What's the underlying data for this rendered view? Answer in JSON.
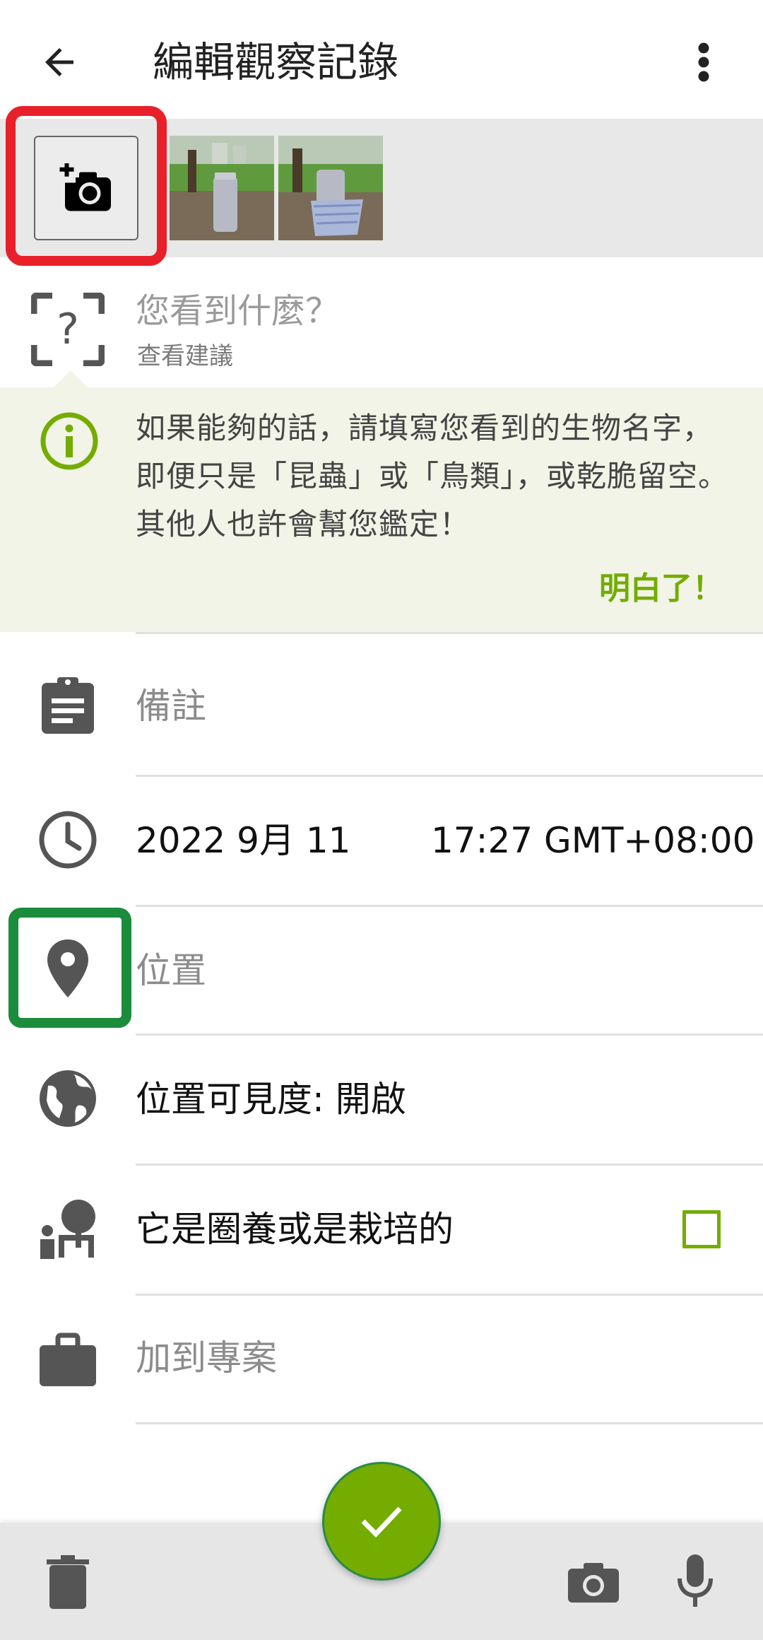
{
  "header": {
    "title": "編輯觀察記錄"
  },
  "species": {
    "question": "您看到什麼？",
    "suggestions": "查看建議"
  },
  "tip": {
    "text": "如果能夠的話，請填寫您看到的生物名字，即便只是「昆蟲」或「鳥類」，或乾脆留空。其他人也許會幫您鑑定！",
    "ok_label": "明白了！"
  },
  "notes": {
    "placeholder": "備註"
  },
  "datetime": {
    "date": "2022 9月 11",
    "time": "17:27 GMT+08:00"
  },
  "location": {
    "label": "位置"
  },
  "visibility": {
    "label": "位置可見度: 開啟"
  },
  "captive": {
    "label": "它是圈養或是栽培的",
    "checked": false
  },
  "project": {
    "label": "加到專案"
  },
  "colors": {
    "accent": "#74ac00",
    "highlight_red": "#e8202a",
    "highlight_green": "#1a8c3c",
    "tip_bg": "#f1f4e6"
  },
  "icons": [
    "back-arrow-icon",
    "more-vert-icon",
    "add-camera-icon",
    "question-frame-icon",
    "info-icon",
    "clipboard-icon",
    "clock-icon",
    "location-pin-icon",
    "globe-icon",
    "captive-plant-icon",
    "briefcase-icon",
    "check-icon",
    "trash-icon",
    "camera-icon",
    "microphone-icon"
  ]
}
